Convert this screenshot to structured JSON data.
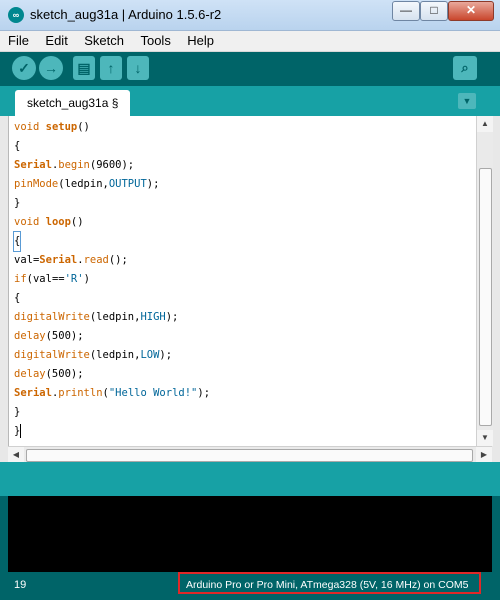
{
  "window": {
    "title": "sketch_aug31a | Arduino 1.5.6-r2",
    "logo_icon": "arduino-infinity-icon",
    "controls": {
      "minimize": "—",
      "maximize": "□",
      "close": "✕"
    }
  },
  "menu": {
    "items": [
      {
        "label": "File"
      },
      {
        "label": "Edit"
      },
      {
        "label": "Sketch"
      },
      {
        "label": "Tools"
      },
      {
        "label": "Help"
      }
    ]
  },
  "toolbar": {
    "verify_icon": "✓",
    "upload_icon": "→",
    "new_icon": "▤",
    "open_icon": "↑",
    "save_icon": "↓",
    "serial_monitor_icon": "⌕"
  },
  "tabs": {
    "active": "sketch_aug31a §",
    "menu_icon": "▼"
  },
  "editor": {
    "lines": [
      "void setup()",
      "{",
      "Serial.begin(9600);",
      "pinMode(ledpin,OUTPUT);",
      "}",
      "void loop()",
      "{",
      "val=Serial.read();",
      "if(val=='R')",
      "{",
      "digitalWrite(ledpin,HIGH);",
      "delay(500);",
      "digitalWrite(ledpin,LOW);",
      "delay(500);",
      "Serial.println(\"Hello World!\");",
      "}",
      "}"
    ]
  },
  "status": {
    "line_number": "19",
    "board": "Arduino Pro or Pro Mini, ATmega328 (5V, 16 MHz) on COM5"
  },
  "colors": {
    "toolbar": "#006468",
    "tabbar": "#17a1a5",
    "button": "#4db7bb",
    "keyword": "#cc6600",
    "constant": "#006699",
    "highlight_border": "#e02828"
  }
}
